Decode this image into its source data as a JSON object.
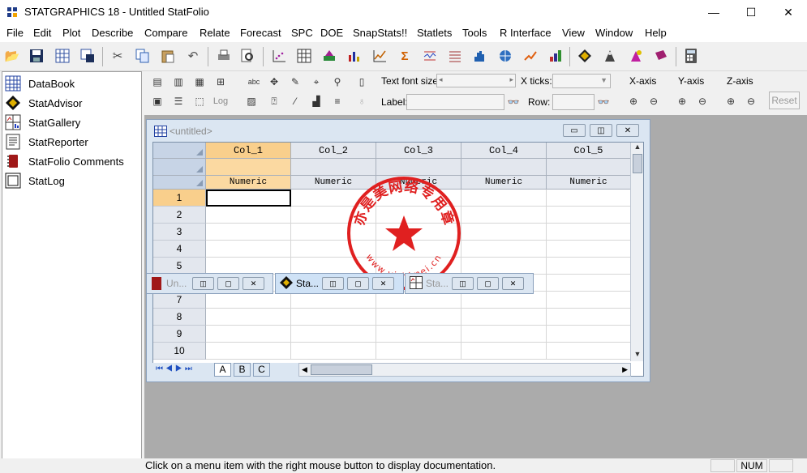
{
  "window": {
    "title": "STATGRAPHICS 18 - Untitled StatFolio",
    "controls": {
      "minimize": "—",
      "maximize": "☐",
      "close": "✕"
    }
  },
  "menu": [
    "File",
    "Edit",
    "Plot",
    "Describe",
    "Compare",
    "Relate",
    "Forecast",
    "SPC",
    "DOE",
    "SnapStats!!",
    "Statlets",
    "Tools",
    "R Interface",
    "View",
    "Window",
    "Help"
  ],
  "toolbar_icons": [
    "open-folder-icon",
    "save-icon",
    "datasheet-icon",
    "print-save-icon",
    "cut-icon",
    "copy-icon",
    "paste-icon",
    "undo-icon",
    "print-icon",
    "print-preview-icon",
    "scatterplot-icon",
    "table-grid-icon",
    "analysis-icon",
    "barchart-icon",
    "line-chart-icon",
    "sigma-chart-icon",
    "control-chart-icon",
    "list-icon",
    "histogram-icon",
    "globe-icon",
    "trend-icon",
    "bar-up-icon",
    "statadvisor-icon",
    "stat-wizard-icon",
    "gallery-icon",
    "book-icon",
    "calculator-icon"
  ],
  "sidebar": {
    "items": [
      {
        "label": "DataBook",
        "icon": "databook-icon"
      },
      {
        "label": "StatAdvisor",
        "icon": "statadvisor-icon"
      },
      {
        "label": "StatGallery",
        "icon": "statgallery-icon"
      },
      {
        "label": "StatReporter",
        "icon": "statreporter-icon"
      },
      {
        "label": "StatFolio Comments",
        "icon": "comments-icon"
      },
      {
        "label": "StatLog",
        "icon": "statlog-icon"
      }
    ]
  },
  "format_bar": {
    "text_font_size_label": "Text font size:",
    "x_ticks_label": "X ticks:",
    "label_label": "Label:",
    "row_label": "Row:",
    "x_axis": "X-axis",
    "y_axis": "Y-axis",
    "z_axis": "Z-axis",
    "reset": "Reset",
    "log_text": "Log",
    "abc_text": "abc"
  },
  "datasheet": {
    "title": "<untitled>",
    "columns": [
      "Col_1",
      "Col_2",
      "Col_3",
      "Col_4",
      "Col_5"
    ],
    "column_types": [
      "Numeric",
      "Numeric",
      "Numeric",
      "Numeric",
      "Numeric"
    ],
    "rows": [
      "1",
      "2",
      "3",
      "4",
      "5",
      "6",
      "7",
      "8",
      "9",
      "10"
    ],
    "selected_row": "1",
    "selected_column": "Col_1",
    "sheet_tabs": [
      "A",
      "B",
      "C"
    ]
  },
  "stamp": {
    "chinese_text": "亦是美网络专用章",
    "url_text": "www.yishimei.cn",
    "color": "#e02020"
  },
  "minimized_windows": [
    {
      "label": "Un...",
      "icon": "statadvisor-doc-icon"
    },
    {
      "label": "Sta...",
      "icon": "statadvisor-icon"
    },
    {
      "label": "Sta...",
      "icon": "statgallery-icon"
    }
  ],
  "status": {
    "message": "Click on a menu item with the right mouse button to display documentation.",
    "num": "NUM"
  },
  "colors": {
    "selection": "#f9cf8c",
    "datasheet_bg": "#dbe6f2",
    "mdi_bg": "#ababab"
  }
}
